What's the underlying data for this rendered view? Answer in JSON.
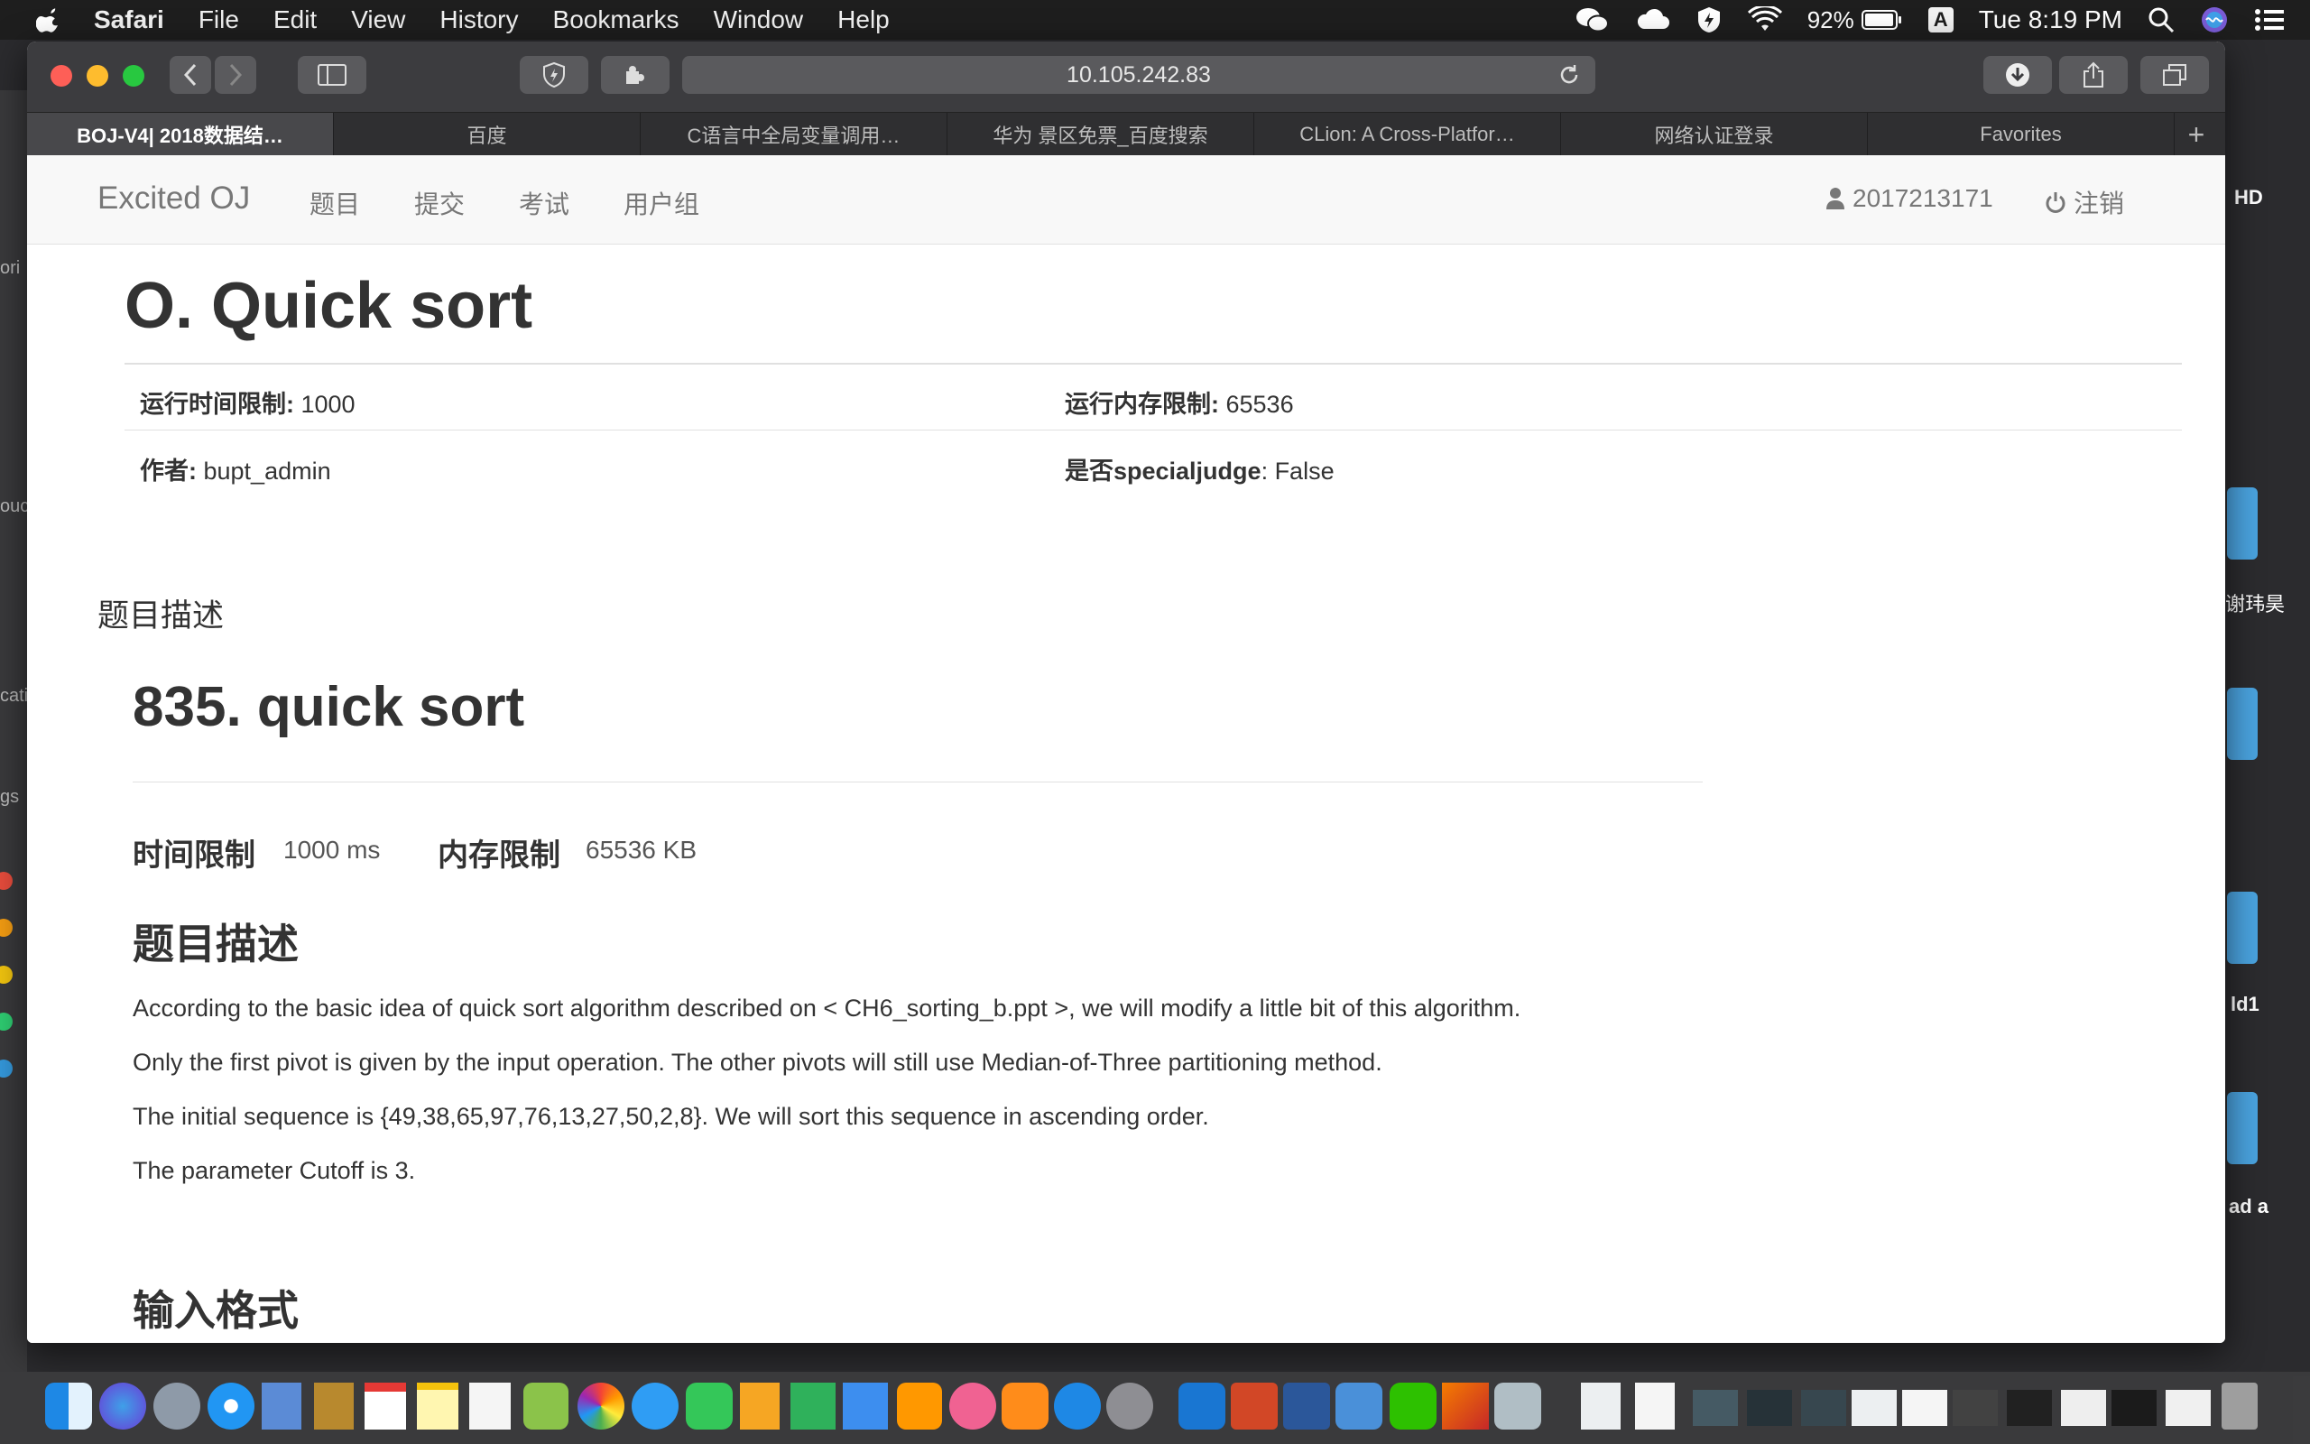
{
  "menubar": {
    "app": "Safari",
    "items": [
      "File",
      "Edit",
      "View",
      "History",
      "Bookmarks",
      "Window",
      "Help"
    ],
    "battery": "92%",
    "input_source": "A",
    "clock": "Tue 8:19 PM"
  },
  "browser": {
    "url": "10.105.242.83",
    "tabs": [
      "BOJ-V4| 2018数据结…",
      "百度",
      "C语言中全局变量调用…",
      "华为 景区免票_百度搜索",
      "CLion: A Cross-Platfor…",
      "网络认证登录",
      "Favorites"
    ],
    "new_tab": "+"
  },
  "site": {
    "brand": "Excited OJ",
    "nav": [
      "题目",
      "提交",
      "考试",
      "用户组"
    ],
    "user": "2017213171",
    "logout": "注销"
  },
  "problem": {
    "title": "O. Quick sort",
    "time_limit_label": "运行时间限制:",
    "time_limit": " 1000",
    "mem_limit_label": "运行内存限制:",
    "mem_limit": " 65536",
    "author_label": "作者:",
    "author": " bupt_admin",
    "special_label": "是否specialjudge",
    "special": ": False",
    "section_desc": "题目描述",
    "inner": {
      "title": "835. quick sort",
      "time_label": "时间限制",
      "time_val": "1000 ms",
      "mem_label": "内存限制",
      "mem_val": "65536 KB",
      "desc_heading": "题目描述",
      "paragraphs": [
        "According to the basic idea of quick sort algorithm described on < CH6_sorting_b.ppt >, we will modify a little bit of this algorithm.",
        "Only the first pivot is given by the input operation. The other pivots will still use Median-of-Three partitioning method.",
        "The initial sequence is {49,38,65,97,76,13,27,50,2,8}. We will sort this sequence in ascending order.",
        "The parameter Cutoff is 3."
      ],
      "input_heading": "输入格式"
    }
  },
  "desktop": {
    "right_labels": [
      "HD",
      "谢玮昊",
      "ld1",
      "ad a"
    ],
    "left_labels": [
      "ori",
      "ouc",
      "cati",
      "gs"
    ]
  },
  "colors": {
    "close": "#fe5f57",
    "minimize": "#febc2e",
    "maximize": "#28c840",
    "menubar": "#1e1e1e",
    "nav_bg": "#f8f8f8"
  }
}
